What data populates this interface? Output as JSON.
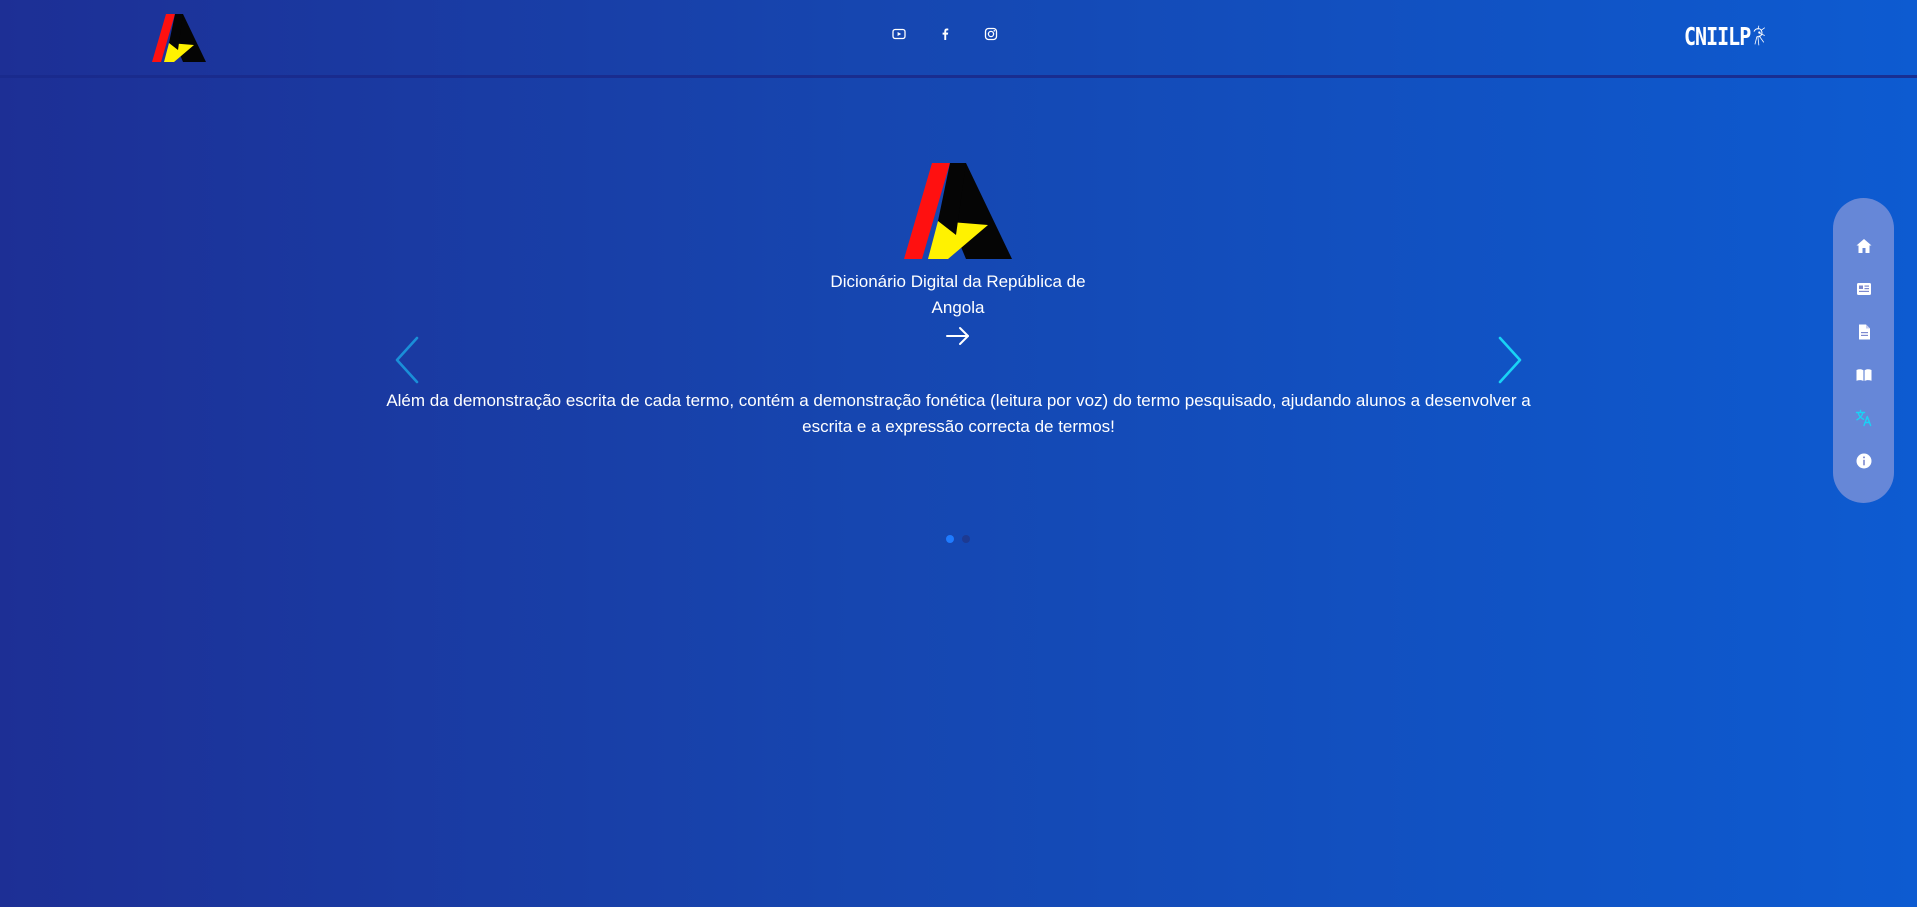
{
  "colors": {
    "background_start": "#1d2f95",
    "background_end": "#0d5bd1",
    "flag_red": "#ff1010",
    "flag_black": "#050505",
    "flag_yellow": "#fff200",
    "accent_cyan": "#19d3f5",
    "dot_active": "#1e7bff"
  },
  "header": {
    "logo_icon": "angola-a-logo-icon",
    "social_links": [
      {
        "name": "youtube",
        "icon": "youtube-icon"
      },
      {
        "name": "facebook",
        "icon": "facebook-icon"
      },
      {
        "name": "instagram",
        "icon": "instagram-icon"
      }
    ],
    "brand": {
      "text": "CNIILP",
      "icon": "cniilp-logo-icon"
    }
  },
  "carousel": {
    "active_index": 0,
    "slide_count": 2,
    "slide": {
      "title": "Dicionário Digital da República de Angola",
      "description": "Além da demonstração escrita de cada termo, contém a demonstração fonética (leitura por voz) do termo pesquisado, ajudando alunos a desenvolver a escrita e a expressão correcta de termos!"
    }
  },
  "side_nav": {
    "items": [
      {
        "icon": "home-icon"
      },
      {
        "icon": "newspaper-icon"
      },
      {
        "icon": "document-icon"
      },
      {
        "icon": "book-open-icon"
      },
      {
        "icon": "translate-icon",
        "active": true
      },
      {
        "icon": "info-icon"
      }
    ]
  }
}
